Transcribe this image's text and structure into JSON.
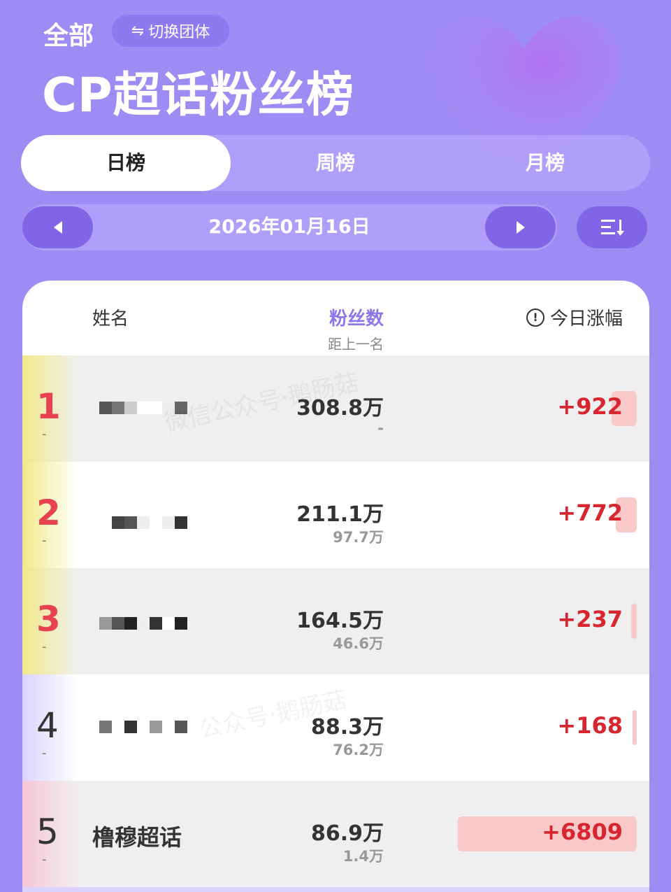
{
  "header": {
    "category": "全部",
    "switch_label": "切换团体",
    "switch_icon": "swap-arrows-icon",
    "title": "CP超话粉丝榜"
  },
  "tabs": [
    {
      "label": "日榜",
      "active": true
    },
    {
      "label": "周榜",
      "active": false
    },
    {
      "label": "月榜",
      "active": false
    }
  ],
  "date_nav": {
    "date": "2026年01月16日",
    "prev_icon": "triangle-left-icon",
    "next_icon": "triangle-right-icon",
    "sort_icon": "sort-list-icon"
  },
  "table": {
    "col_name": "姓名",
    "col_fans": "粉丝数",
    "col_fans_sub": "距上一名",
    "col_gain": "今日涨幅",
    "rows": [
      {
        "rank": "1",
        "rank_change": "-",
        "name": "",
        "fans": "308.8万",
        "gap": "-",
        "gain": "+922",
        "gain_level": 0.03
      },
      {
        "rank": "2",
        "rank_change": "-",
        "name": "",
        "fans": "211.1万",
        "gap": "97.7万",
        "gain": "+772",
        "gain_level": 0.03
      },
      {
        "rank": "3",
        "rank_change": "-",
        "name": "",
        "fans": "164.5万",
        "gap": "46.6万",
        "gain": "+237",
        "gain_level": 0.01
      },
      {
        "rank": "4",
        "rank_change": "-",
        "name": "",
        "fans": "88.3万",
        "gap": "76.2万",
        "gain": "+168",
        "gain_level": 0.01
      },
      {
        "rank": "5",
        "rank_change": "-",
        "name": "橹穆超话",
        "fans": "86.9万",
        "gap": "1.4万",
        "gain": "+6809",
        "gain_level": 1.0
      }
    ]
  },
  "colors": {
    "background": "#9d8cf3",
    "accent_button": "#7f66e6",
    "gain_red": "#d7262f",
    "rank_top": "#e84150",
    "fans_header": "#8a78ea"
  }
}
